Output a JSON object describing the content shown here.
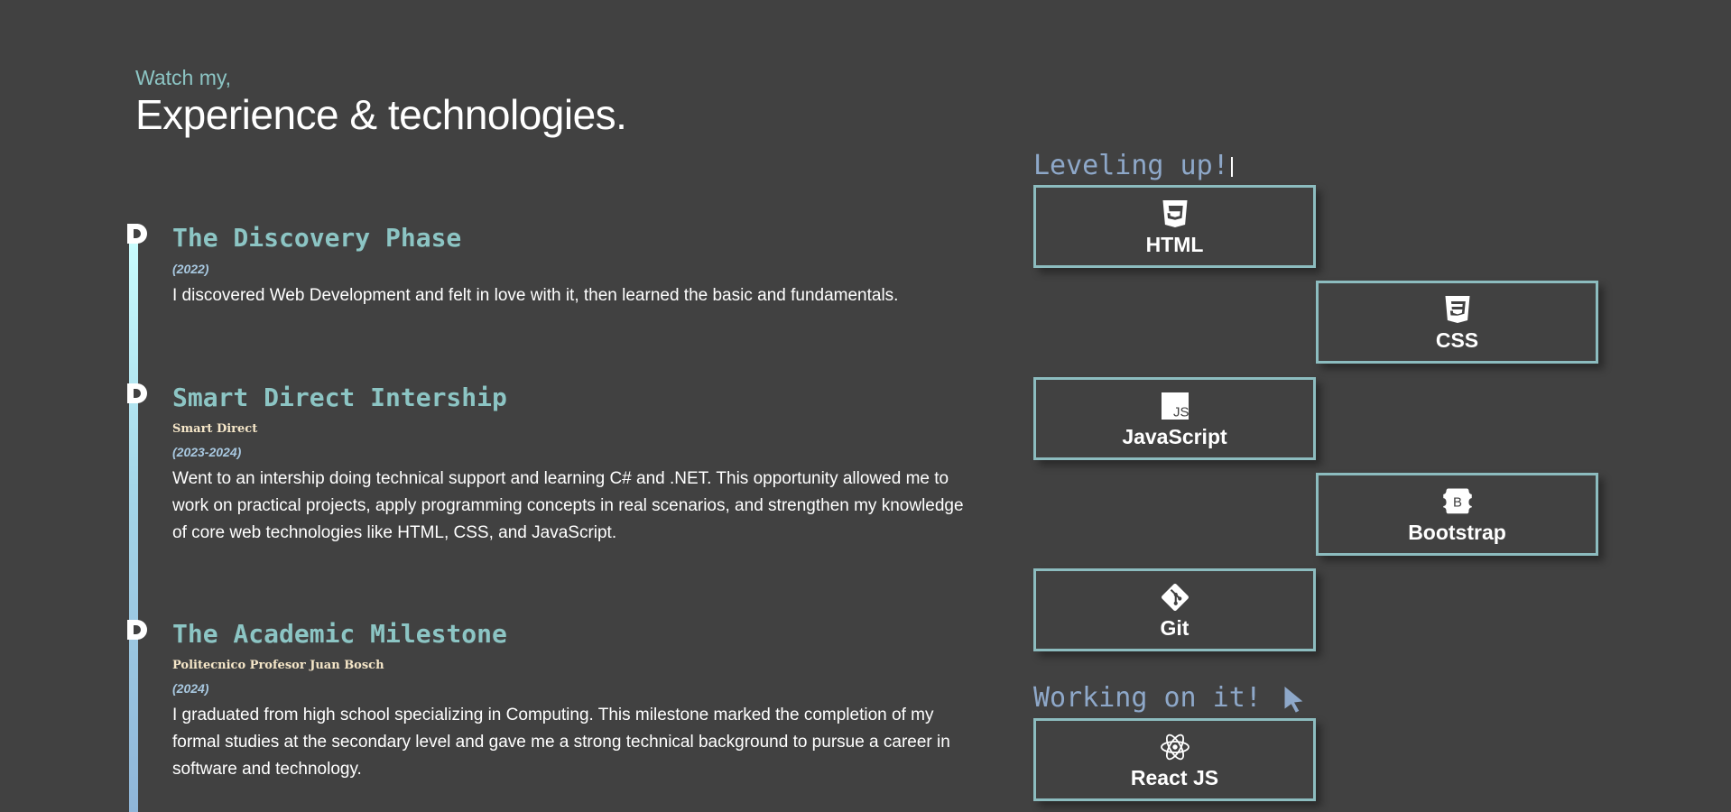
{
  "intro": {
    "subtitle": "Watch my,",
    "title": "Experience & technologies."
  },
  "timeline": [
    {
      "title": "The Discovery Phase",
      "org": "",
      "date": "(2022)",
      "description": "I discovered Web Development and felt in love with it, then learned the basic and fundamentals."
    },
    {
      "title": "Smart Direct Intership",
      "org": "Smart Direct",
      "date": "(2023-2024)",
      "description": "Went to an intership doing technical support and learning C# and .NET. This opportunity allowed me to work on practical projects, apply programming concepts in real scenarios, and strengthen my knowledge of core web technologies like HTML, CSS, and JavaScript."
    },
    {
      "title": "The Academic Milestone",
      "org": "Politecnico Profesor Juan Bosch",
      "date": "(2024)",
      "description": "I graduated from high school specializing in Computing. This milestone marked the completion of my formal studies at the secondary level and gave me a strong technical background to pursue a career in software and technology."
    }
  ],
  "tech": {
    "leveling_heading": "Leveling up!",
    "working_heading": "Working on it!",
    "leveling": [
      {
        "label": "HTML",
        "icon": "html5-icon"
      },
      {
        "label": "CSS",
        "icon": "css3-icon"
      },
      {
        "label": "JavaScript",
        "icon": "javascript-icon"
      },
      {
        "label": "Bootstrap",
        "icon": "bootstrap-icon"
      },
      {
        "label": "Git",
        "icon": "git-icon"
      }
    ],
    "working": [
      {
        "label": "React JS",
        "icon": "react-icon"
      }
    ]
  },
  "colors": {
    "background": "#414141",
    "accent_teal": "#8cc5c4",
    "heading_blue": "#8ea8c9",
    "card_border": "#8cbcbf"
  }
}
